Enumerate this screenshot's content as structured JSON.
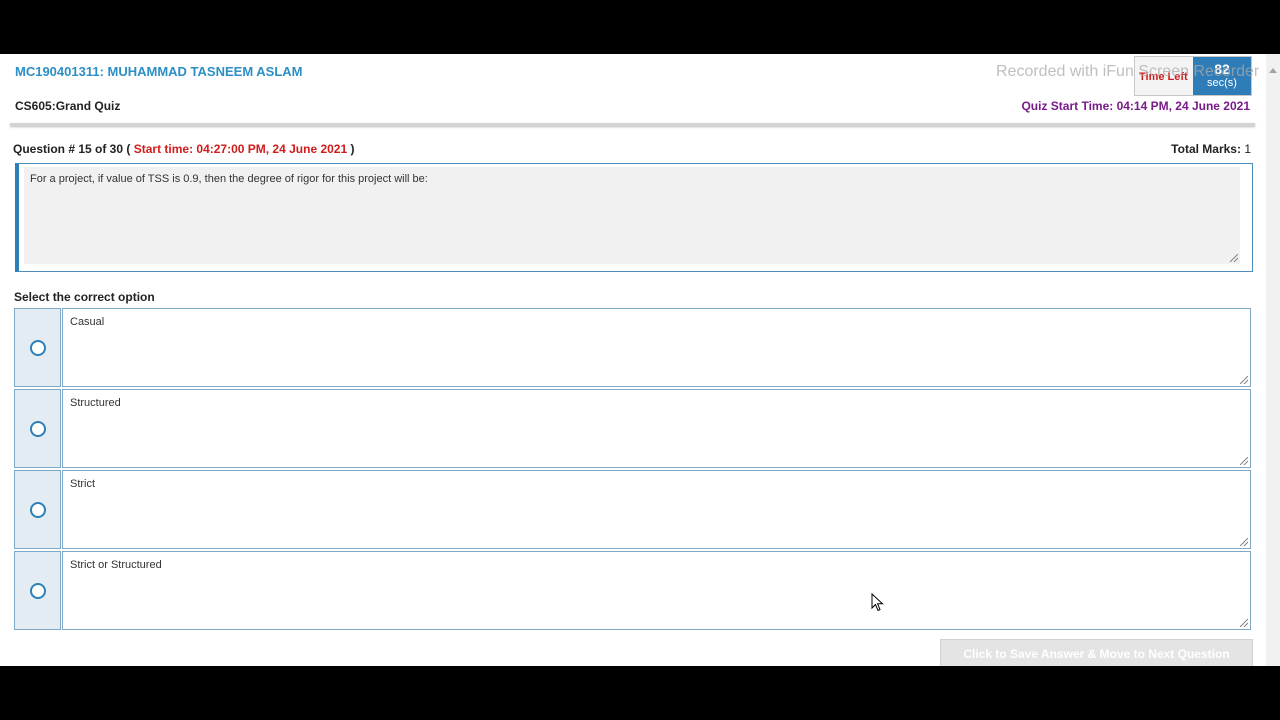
{
  "header": {
    "student": "MC190401311: MUHAMMAD TASNEEM ASLAM",
    "quiz_name": "CS605:Grand Quiz",
    "quiz_start_time": "Quiz Start Time: 04:14 PM, 24 June 2021",
    "watermark": "Recorded with iFun Screen Recorder"
  },
  "timer": {
    "label": "Time Left",
    "value": "82",
    "unit": "sec(s)"
  },
  "question": {
    "number_prefix": "Question # 15 of 30 (",
    "start_time": "Start time: 04:27:00 PM, 24 June 2021",
    "number_suffix": ")",
    "total_marks_label": "Total Marks:",
    "total_marks_value": "1",
    "text": "For a project, if value of TSS is 0.9, then the degree of rigor for this project will be:"
  },
  "options_label": "Select the correct option",
  "options": [
    {
      "text": "Casual",
      "selected": false
    },
    {
      "text": "Structured",
      "selected": false
    },
    {
      "text": "Strict",
      "selected": false
    },
    {
      "text": "Strict or Structured",
      "selected": false
    }
  ],
  "save_button": "Click to Save Answer & Move to Next Question",
  "colors": {
    "accent_blue": "#2b8fc6",
    "timer_bg": "#2e7cb8",
    "start_time_red": "#d21b1b",
    "quiz_start_purple": "#7a1b8a",
    "option_cell_bg": "#e3ecf3"
  }
}
